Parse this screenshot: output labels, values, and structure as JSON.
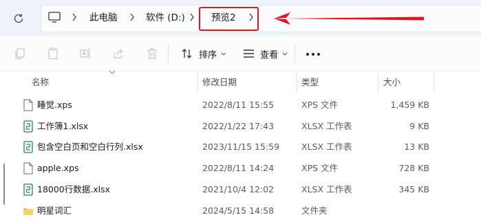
{
  "address_bar": {
    "breadcrumbs": [
      "此电脑",
      "软件 (D:)",
      "预览2"
    ],
    "icons": {
      "refresh": "refresh-icon",
      "computer": "computer-icon",
      "chevron": "chevron-right-icon"
    },
    "highlight_color": "#e8121b"
  },
  "toolbar": {
    "icons": [
      "copy-icon",
      "paste-icon",
      "rename-icon",
      "share-icon",
      "delete-icon"
    ],
    "sort_label": "排序",
    "view_label": "查看",
    "more_label": "更多"
  },
  "list": {
    "columns": {
      "name": "名称",
      "date": "修改日期",
      "type": "类型",
      "size": "大小"
    },
    "rows": [
      {
        "icon": "document-icon",
        "name": "睡觉.xps",
        "date": "2022/8/11 15:55",
        "type": "XPS 文件",
        "size": "1,459 KB"
      },
      {
        "icon": "excel-icon",
        "name": "工作簿1.xlsx",
        "date": "2022/1/22 17:43",
        "type": "XLSX 工作表",
        "size": "9 KB"
      },
      {
        "icon": "excel-icon",
        "name": "包含空白页和空白行列.xlsx",
        "date": "2023/11/15 15:59",
        "type": "XLSX 工作表",
        "size": "13 KB"
      },
      {
        "icon": "document-icon",
        "name": "apple.xps",
        "date": "2022/8/11 14:24",
        "type": "XPS 文件",
        "size": "728 KB"
      },
      {
        "icon": "excel-icon",
        "name": "18000行数据.xlsx",
        "date": "2021/10/4 12:02",
        "type": "XLSX 工作表",
        "size": "345 KB"
      },
      {
        "icon": "folder-icon",
        "name": "明星词汇",
        "date": "2024/5/15 14:58",
        "type": "文件夹",
        "size": ""
      }
    ]
  },
  "colors": {
    "accent_red": "#e8121b",
    "excel_green": "#1e8c4e",
    "folder_yellow": "#f3c44c"
  }
}
